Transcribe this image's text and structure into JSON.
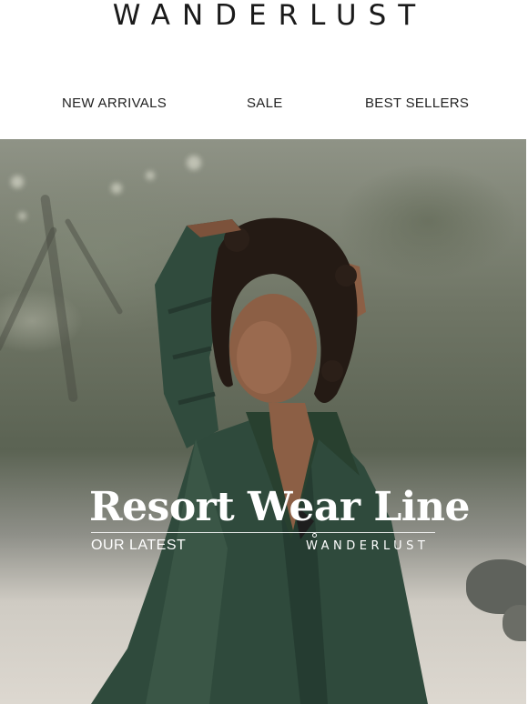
{
  "header": {
    "logo": "WANDERLUST"
  },
  "nav": {
    "items": [
      {
        "label": "NEW ARRIVALS"
      },
      {
        "label": "SALE"
      },
      {
        "label": "BEST SELLERS"
      }
    ]
  },
  "hero": {
    "title": "Resort Wear Line",
    "subtitle": "OUR LATEST",
    "brand": "WANDERLUST",
    "colors": {
      "shirt": "#2f4a3c",
      "hair": "#241a14",
      "skin": "#8c5f45",
      "sand": "#d9d4cb"
    }
  }
}
